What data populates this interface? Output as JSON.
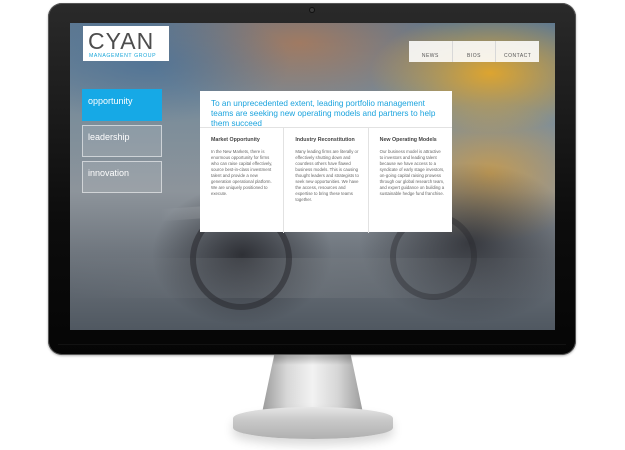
{
  "brand": {
    "name": "CYAN",
    "tagline": "MANAGEMENT GROUP",
    "accent_color": "#16a9e6"
  },
  "topnav": {
    "items": [
      "NEWS",
      "BIOS",
      "CONTACT"
    ]
  },
  "sidenav": {
    "items": [
      {
        "label": "opportunity",
        "active": true
      },
      {
        "label": "leadership",
        "active": false
      },
      {
        "label": "innovation",
        "active": false
      }
    ]
  },
  "main": {
    "headline": "To an unprecedented extent, leading portfolio management teams are seeking new operating models and partners to help them succeed",
    "columns": [
      {
        "title": "Market  Opportunity",
        "body": "In the New Markets, there is enormous opportunity for firms who can raise capital effectively, source best-in-class investment talent and provide a new generation operational platform. We are uniquely positioned to execute."
      },
      {
        "title": "Industry Reconstitution",
        "body": "Many leading firms are literally or effectively shutting down and countless others have flawed business models. This is causing thought leaders and strategists to seek new opportunities. We have the access, resources and expertise to bring these teams together."
      },
      {
        "title": "New Operating Models",
        "body": "Our business model is attractive to investors and leading talent because we have access to a syndicate of early stage investors, on-going capital raising prowess through our global research team, and expert guidance on building a sustainable hedge fund franchise."
      }
    ]
  }
}
